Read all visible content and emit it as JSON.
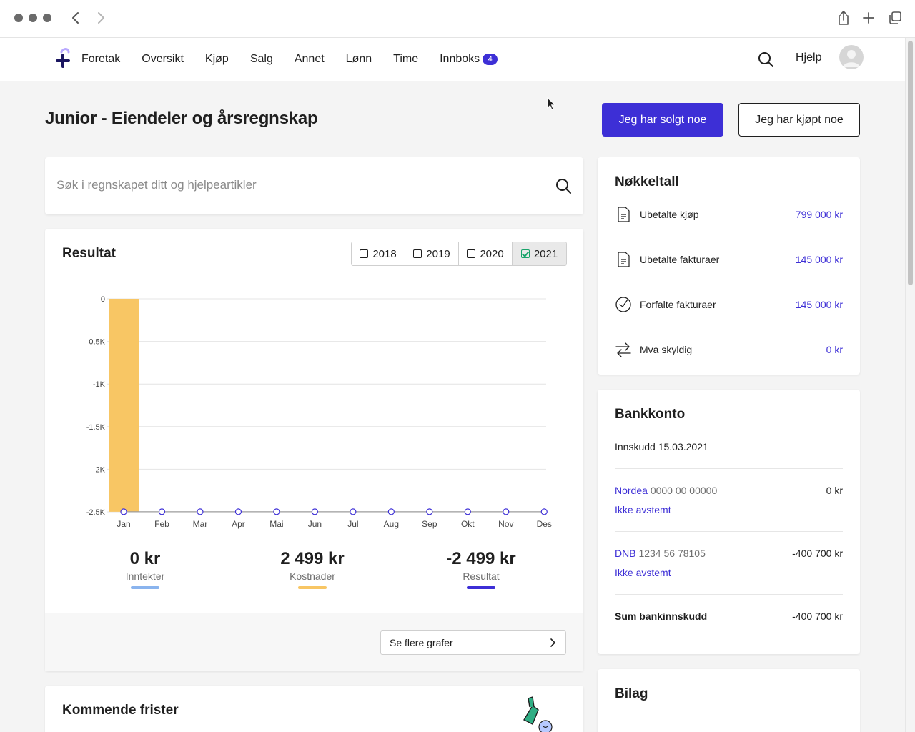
{
  "app": {
    "menu": [
      {
        "label": "Foretak"
      },
      {
        "label": "Oversikt"
      },
      {
        "label": "Kjøp"
      },
      {
        "label": "Salg"
      },
      {
        "label": "Annet"
      },
      {
        "label": "Lønn"
      },
      {
        "label": "Time"
      },
      {
        "label": "Innboks",
        "badge": "4"
      }
    ],
    "help_label": "Hjelp",
    "icons": {
      "back": "chevron-left-icon",
      "forward": "chevron-right-icon",
      "share": "share-icon",
      "new_tab": "plus-icon",
      "tabs": "tabs-icon",
      "search": "search-icon",
      "avatar": "user-avatar-icon"
    }
  },
  "page": {
    "title": "Junior - Eiendeler og årsregnskap",
    "sold_button": "Jeg har solgt noe",
    "bought_button": "Jeg har kjøpt noe"
  },
  "search": {
    "placeholder": "Søk i regnskapet ditt og hjelpeartikler"
  },
  "result": {
    "title": "Resultat",
    "years": [
      {
        "label": "2018",
        "checked": false
      },
      {
        "label": "2019",
        "checked": false
      },
      {
        "label": "2020",
        "checked": false
      },
      {
        "label": "2021",
        "checked": true
      }
    ],
    "summary": [
      {
        "value": "0 kr",
        "label": "Inntekter",
        "color": "#8ab4ee"
      },
      {
        "value": "2 499 kr",
        "label": "Kostnader",
        "color": "#f8c664"
      },
      {
        "value": "-2 499 kr",
        "label": "Resultat",
        "color": "#3d2fd6"
      }
    ],
    "more_button": "Se flere grafer"
  },
  "chart_data": {
    "type": "bar",
    "categories": [
      "Jan",
      "Feb",
      "Mar",
      "Apr",
      "Mai",
      "Jun",
      "Jul",
      "Aug",
      "Sep",
      "Okt",
      "Nov",
      "Des"
    ],
    "y_ticks": [
      "0",
      "-0.5K",
      "-1K",
      "-1.5K",
      "-2K",
      "-2.5K"
    ],
    "ylim": [
      -2500,
      0
    ],
    "series": [
      {
        "kind": "bar",
        "color": "#f8c664",
        "values": [
          -2499,
          0,
          0,
          0,
          0,
          0,
          0,
          0,
          0,
          0,
          0,
          0
        ]
      },
      {
        "kind": "line",
        "color": "#3d2fd6",
        "values": [
          -2499,
          -2499,
          -2499,
          -2499,
          -2499,
          -2499,
          -2499,
          -2499,
          -2499,
          -2499,
          -2499,
          -2499
        ]
      }
    ],
    "grid": true
  },
  "deadlines": {
    "title": "Kommende frister"
  },
  "key_figures": {
    "title": "Nøkkeltall",
    "rows": [
      {
        "label": "Ubetalte kjøp",
        "value": "799 000 kr",
        "icon": "document-icon"
      },
      {
        "label": "Ubetalte fakturaer",
        "value": "145 000 kr",
        "icon": "invoice-icon"
      },
      {
        "label": "Forfalte fakturaer",
        "value": "145 000 kr",
        "icon": "clock-check-icon"
      },
      {
        "label": "Mva skyldig",
        "value": "0 kr",
        "icon": "swap-arrows-icon"
      }
    ]
  },
  "bank": {
    "title": "Bankkonto",
    "subtitle": "Innskudd 15.03.2021",
    "accounts": [
      {
        "bank": "Nordea",
        "account": "0000 00 00000",
        "amount": "0 kr",
        "status": "Ikke avstemt"
      },
      {
        "bank": "DNB",
        "account": "1234 56 78105",
        "amount": "-400 700 kr",
        "status": "Ikke avstemt"
      }
    ],
    "sum_label": "Sum bankinnskudd",
    "sum_amount": "-400 700 kr"
  },
  "bilag": {
    "title": "Bilag"
  }
}
